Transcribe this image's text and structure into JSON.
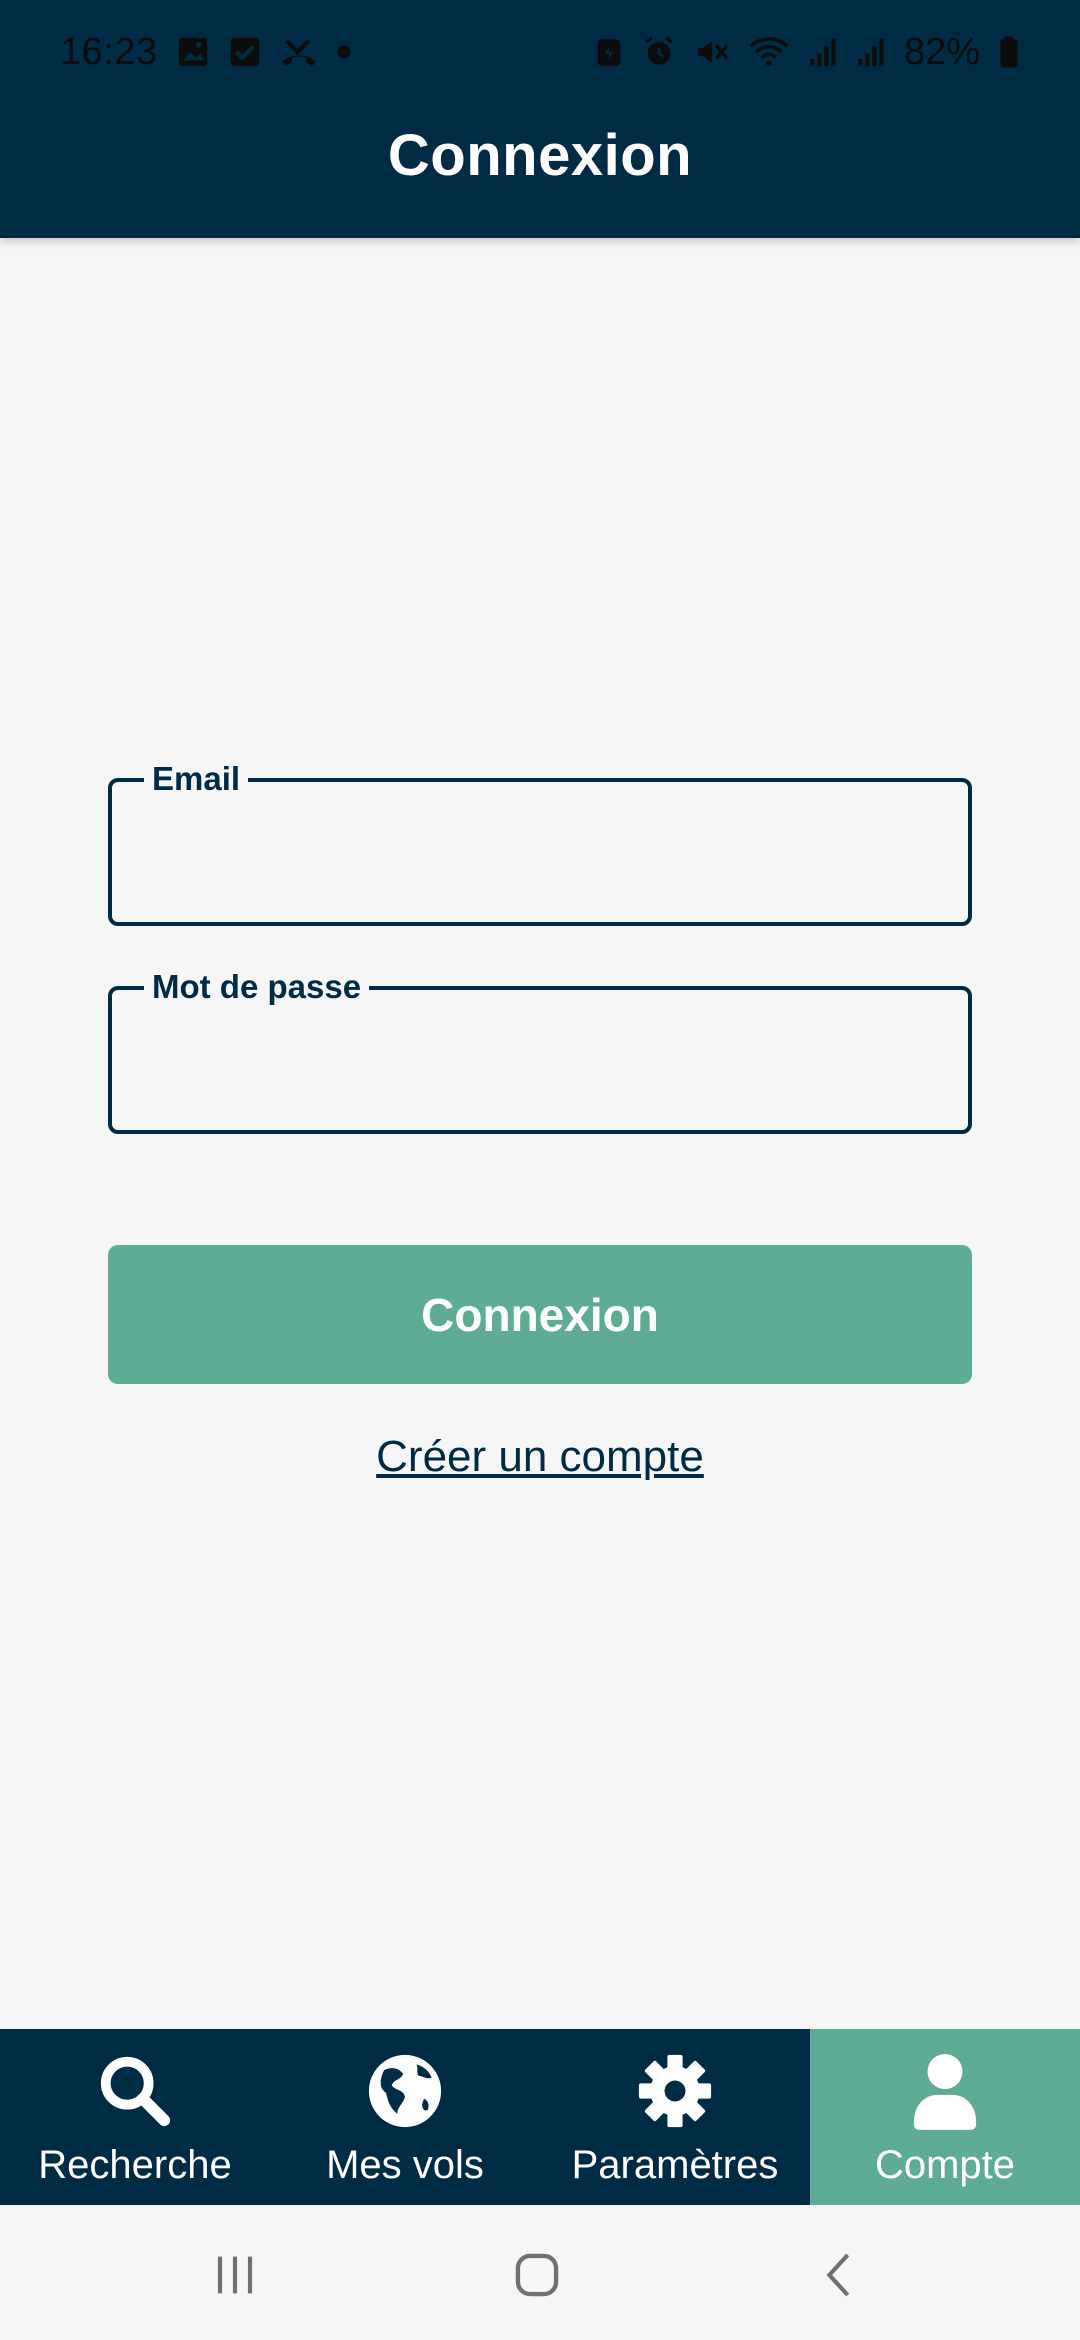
{
  "status_bar": {
    "time": "16:23",
    "battery": "82%",
    "left_icons": [
      "image-icon",
      "checkbox-icon",
      "missed-call-icon",
      "dot-icon"
    ],
    "right_icons": [
      "battery-saver-icon",
      "alarm-icon",
      "mute-icon",
      "wifi-icon",
      "signal-icon",
      "signal-icon",
      "battery-icon"
    ]
  },
  "header": {
    "title": "Connexion"
  },
  "form": {
    "email_label": "Email",
    "email_value": "",
    "password_label": "Mot de passe",
    "password_value": "",
    "login_button": "Connexion",
    "create_account_link": "Créer un compte"
  },
  "bottom_nav": {
    "items": [
      {
        "label": "Recherche",
        "icon": "search-icon",
        "active": false
      },
      {
        "label": "Mes vols",
        "icon": "globe-icon",
        "active": false
      },
      {
        "label": "Paramètres",
        "icon": "gear-icon",
        "active": false
      },
      {
        "label": "Compte",
        "icon": "user-icon",
        "active": true
      }
    ]
  },
  "colors": {
    "primary": "#002b45",
    "accent": "#5eac96",
    "background": "#f6f6f6"
  }
}
